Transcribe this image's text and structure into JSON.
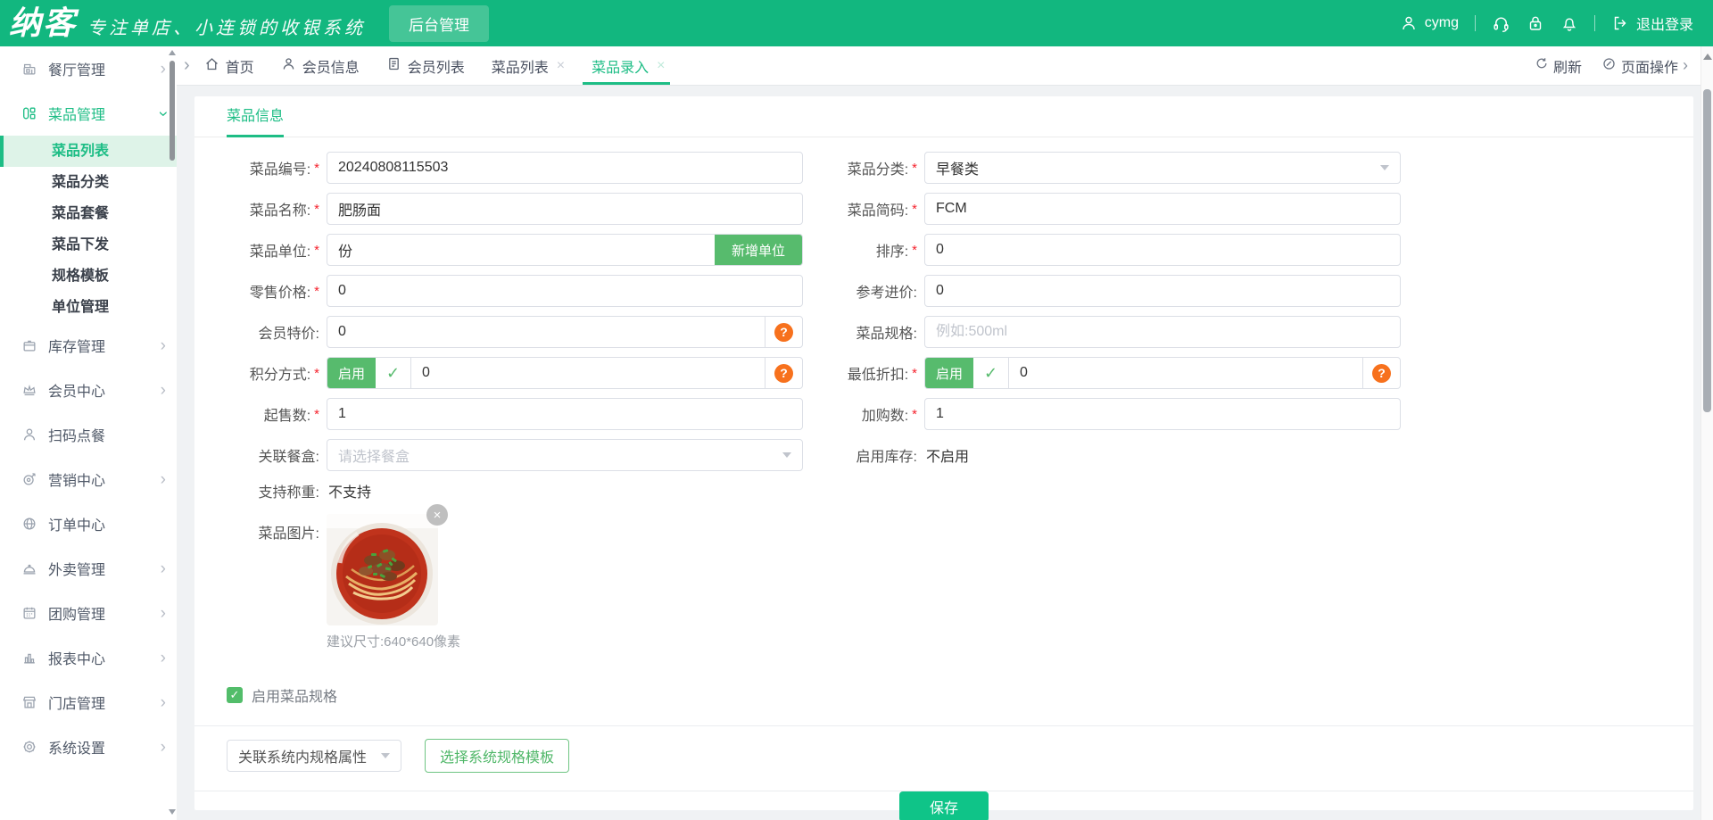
{
  "header": {
    "logo": "纳客",
    "tagline": "专注单店、小连锁的收银系统",
    "nav_tab": "后台管理",
    "username": "cymg",
    "logout_label": "退出登录"
  },
  "sidebar": {
    "items": [
      {
        "label": "餐厅管理"
      },
      {
        "label": "菜品管理"
      },
      {
        "label": "库存管理"
      },
      {
        "label": "会员中心"
      },
      {
        "label": "扫码点餐"
      },
      {
        "label": "营销中心"
      },
      {
        "label": "订单中心"
      },
      {
        "label": "外卖管理"
      },
      {
        "label": "团购管理"
      },
      {
        "label": "报表中心"
      },
      {
        "label": "门店管理"
      },
      {
        "label": "系统设置"
      }
    ],
    "dish_submenu": [
      {
        "label": "菜品列表",
        "active": true
      },
      {
        "label": "菜品分类"
      },
      {
        "label": "菜品套餐"
      },
      {
        "label": "菜品下发"
      },
      {
        "label": "规格模板"
      },
      {
        "label": "单位管理"
      }
    ]
  },
  "tabbar": {
    "tabs": [
      {
        "label": "首页"
      },
      {
        "label": "会员信息"
      },
      {
        "label": "会员列表"
      },
      {
        "label": "菜品列表",
        "closable": true
      },
      {
        "label": "菜品录入",
        "closable": true,
        "active": true
      }
    ],
    "refresh_label": "刷新",
    "page_ops_label": "页面操作"
  },
  "form": {
    "section_title": "菜品信息",
    "required_mark": "*",
    "dish_code": {
      "label": "菜品编号:",
      "value": "20240808115503"
    },
    "dish_category": {
      "label": "菜品分类:",
      "value": "早餐类"
    },
    "dish_name": {
      "label": "菜品名称:",
      "value": "肥肠面"
    },
    "dish_shortcode": {
      "label": "菜品简码:",
      "value": "FCM"
    },
    "dish_unit": {
      "label": "菜品单位:",
      "value": "份",
      "button_label": "新增单位"
    },
    "sort_order": {
      "label": "排序:",
      "value": "0"
    },
    "retail_price": {
      "label": "零售价格:",
      "value": "0"
    },
    "reference_cost": {
      "label": "参考进价:",
      "value": "0"
    },
    "member_price": {
      "label": "会员特价:",
      "value": "0"
    },
    "dish_spec": {
      "label": "菜品规格:",
      "placeholder": "例如:500ml"
    },
    "points_mode": {
      "label": "积分方式:",
      "toggle_label": "启用",
      "value": "0"
    },
    "min_discount": {
      "label": "最低折扣:",
      "toggle_label": "启用",
      "value": "0"
    },
    "min_order_qty": {
      "label": "起售数:",
      "value": "1"
    },
    "add_cart_qty": {
      "label": "加购数:",
      "value": "1"
    },
    "meal_box": {
      "label": "关联餐盒:",
      "placeholder": "请选择餐盒"
    },
    "enable_stock": {
      "label": "启用库存:",
      "value": "不启用"
    },
    "weighing": {
      "label": "支持称重:",
      "value": "不支持"
    },
    "dish_image": {
      "label": "菜品图片:",
      "hint": "建议尺寸:640*640像素"
    }
  },
  "spec_section": {
    "enable_label": "启用菜品规格",
    "attr_select_label": "关联系统内规格属性",
    "template_button_label": "选择系统规格模板"
  },
  "footer": {
    "save_label": "保存"
  },
  "icons": {
    "chevron_right": "›",
    "close": "×",
    "check": "✓"
  },
  "colors": {
    "header_green": "#12b77f",
    "nav_tab_green": "#45c597",
    "accent_green": "#1dbd85",
    "button_green": "#57bb6d",
    "save_green": "#0fc488",
    "help_orange": "#f7711d",
    "required_red": "#f5222d",
    "active_item_bg": "#def3e8"
  }
}
